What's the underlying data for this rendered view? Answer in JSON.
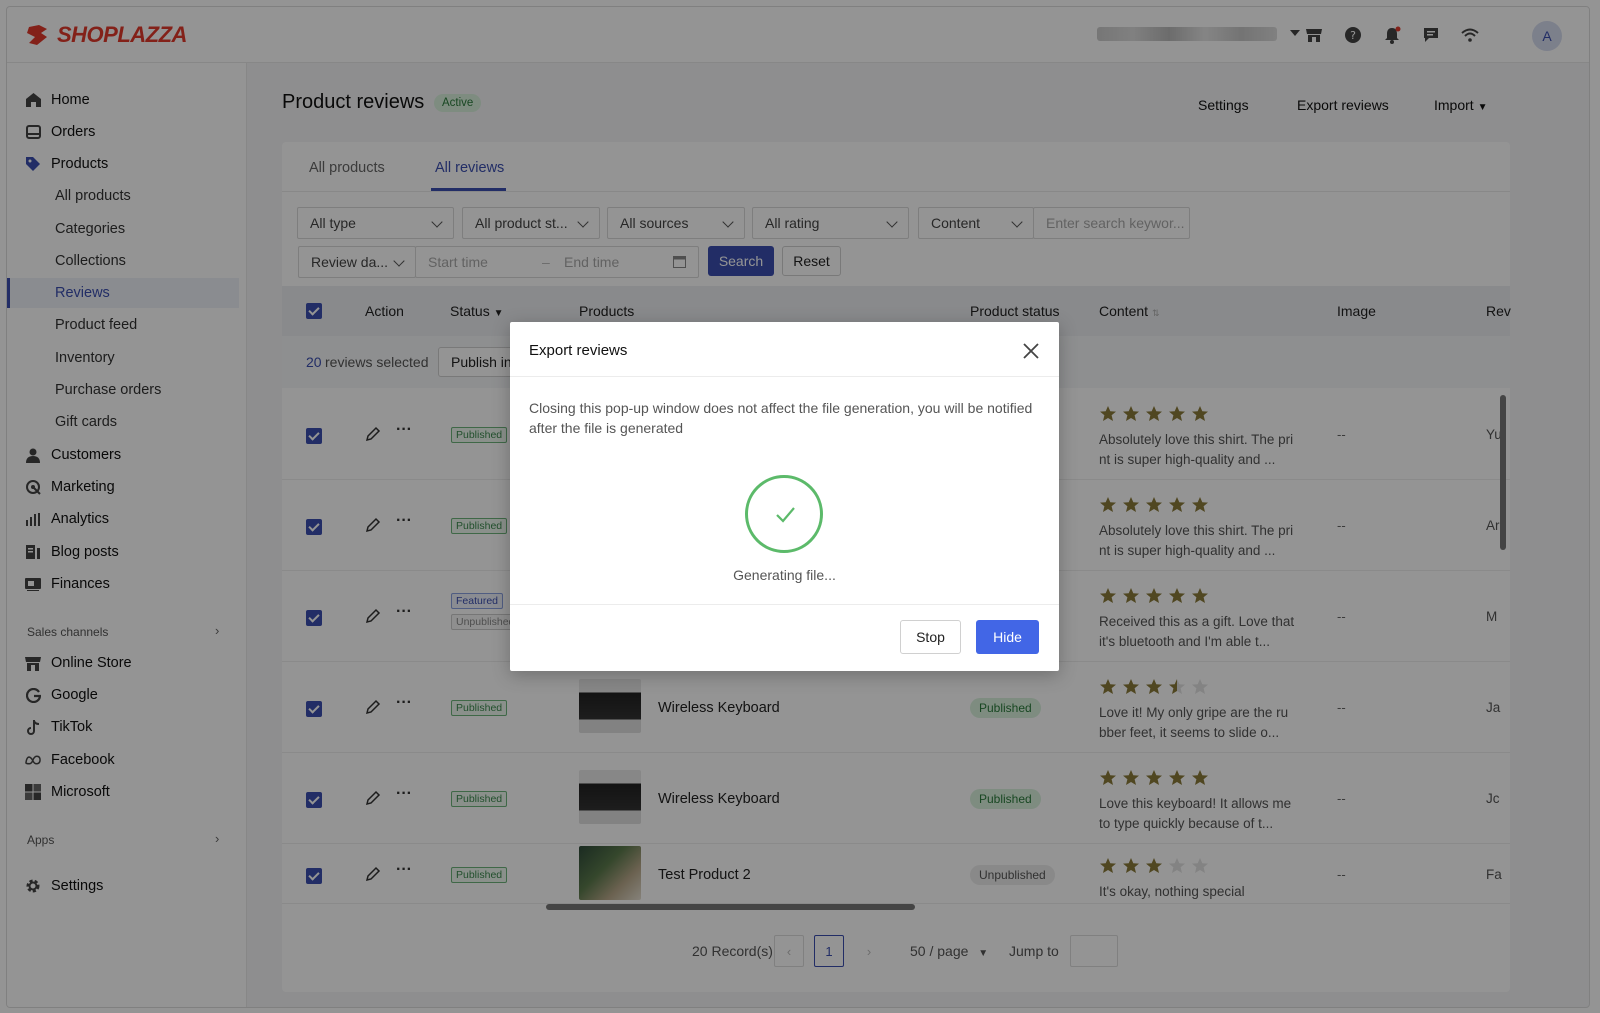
{
  "app": {
    "brand": "SHOPLAZZA",
    "avatar_letter": "A"
  },
  "sidebar": {
    "items": [
      {
        "label": "Home"
      },
      {
        "label": "Orders"
      },
      {
        "label": "Products"
      },
      {
        "label": "All products"
      },
      {
        "label": "Categories"
      },
      {
        "label": "Collections"
      },
      {
        "label": "Reviews"
      },
      {
        "label": "Product feed"
      },
      {
        "label": "Inventory"
      },
      {
        "label": "Purchase orders"
      },
      {
        "label": "Gift cards"
      },
      {
        "label": "Customers"
      },
      {
        "label": "Marketing"
      },
      {
        "label": "Analytics"
      },
      {
        "label": "Blog posts"
      },
      {
        "label": "Finances"
      }
    ],
    "sales_channels_label": "Sales channels",
    "channels": [
      {
        "label": "Online Store"
      },
      {
        "label": "Google"
      },
      {
        "label": "TikTok"
      },
      {
        "label": "Facebook"
      },
      {
        "label": "Microsoft"
      }
    ],
    "apps_label": "Apps",
    "settings_label": "Settings"
  },
  "header": {
    "title": "Product reviews",
    "status_badge": "Active",
    "settings": "Settings",
    "export": "Export reviews",
    "import": "Import"
  },
  "tabs": [
    {
      "label": "All products"
    },
    {
      "label": "All reviews"
    }
  ],
  "filters": {
    "type": "All type",
    "product_status": "All product st...",
    "sources": "All sources",
    "rating": "All rating",
    "content": "Content",
    "search_placeholder": "Enter search keywor...",
    "review_date": "Review da...",
    "start_time": "Start time",
    "end_time": "End time",
    "search_btn": "Search",
    "reset_btn": "Reset"
  },
  "table": {
    "columns": {
      "action": "Action",
      "status": "Status",
      "products": "Products",
      "product_status": "Product status",
      "content": "Content",
      "image": "Image",
      "reviewer": "Rev"
    },
    "selected_count": "20",
    "selected_text": "reviews selected",
    "bulk_action": "Publish in",
    "rows": [
      {
        "tags": [
          "Published"
        ],
        "product": "",
        "product_status": "",
        "rating": 5,
        "content": "Absolutely love this shirt. The print is super high-quality and ...",
        "image": "--",
        "reviewer": "Yu"
      },
      {
        "tags": [
          "Published"
        ],
        "product": "",
        "product_status": "",
        "rating": 5,
        "content": "Absolutely love this shirt. The print is super high-quality and ...",
        "image": "--",
        "reviewer": "Ar"
      },
      {
        "tags": [
          "Featured",
          "Unpublished"
        ],
        "product": "",
        "product_status": "",
        "rating": 5,
        "content": "Received this as a gift. Love that it's bluetooth and I'm able t...",
        "image": "--",
        "reviewer": "M"
      },
      {
        "tags": [
          "Published"
        ],
        "product": "Wireless Keyboard",
        "product_status": "Published",
        "rating": 3.5,
        "content": "Love it! My only gripe are the rubber feet, it seems to slide o...",
        "image": "--",
        "reviewer": "Ja"
      },
      {
        "tags": [
          "Published"
        ],
        "product": "Wireless Keyboard",
        "product_status": "Published",
        "rating": 5,
        "content": "Love this keyboard! It allows me to type quickly because of t...",
        "image": "--",
        "reviewer": "Jc"
      },
      {
        "tags": [
          "Published"
        ],
        "product": "Test Product 2",
        "product_status": "Unpublished",
        "rating": 3,
        "content": "It's okay, nothing special",
        "image": "--",
        "reviewer": "Fa"
      }
    ]
  },
  "pagination": {
    "records": "20 Record(s)",
    "current_page": "1",
    "page_size": "50 / page",
    "jump_to": "Jump to"
  },
  "modal": {
    "title": "Export reviews",
    "message": "Closing this pop-up window does not affect the file generation, you will be notified after the file is generated",
    "status": "Generating file...",
    "stop": "Stop",
    "hide": "Hide"
  },
  "colors": {
    "accent": "#3b4fb0",
    "brand": "#e23a2c",
    "success": "#5cba6a",
    "star": "#8a7a3a"
  }
}
